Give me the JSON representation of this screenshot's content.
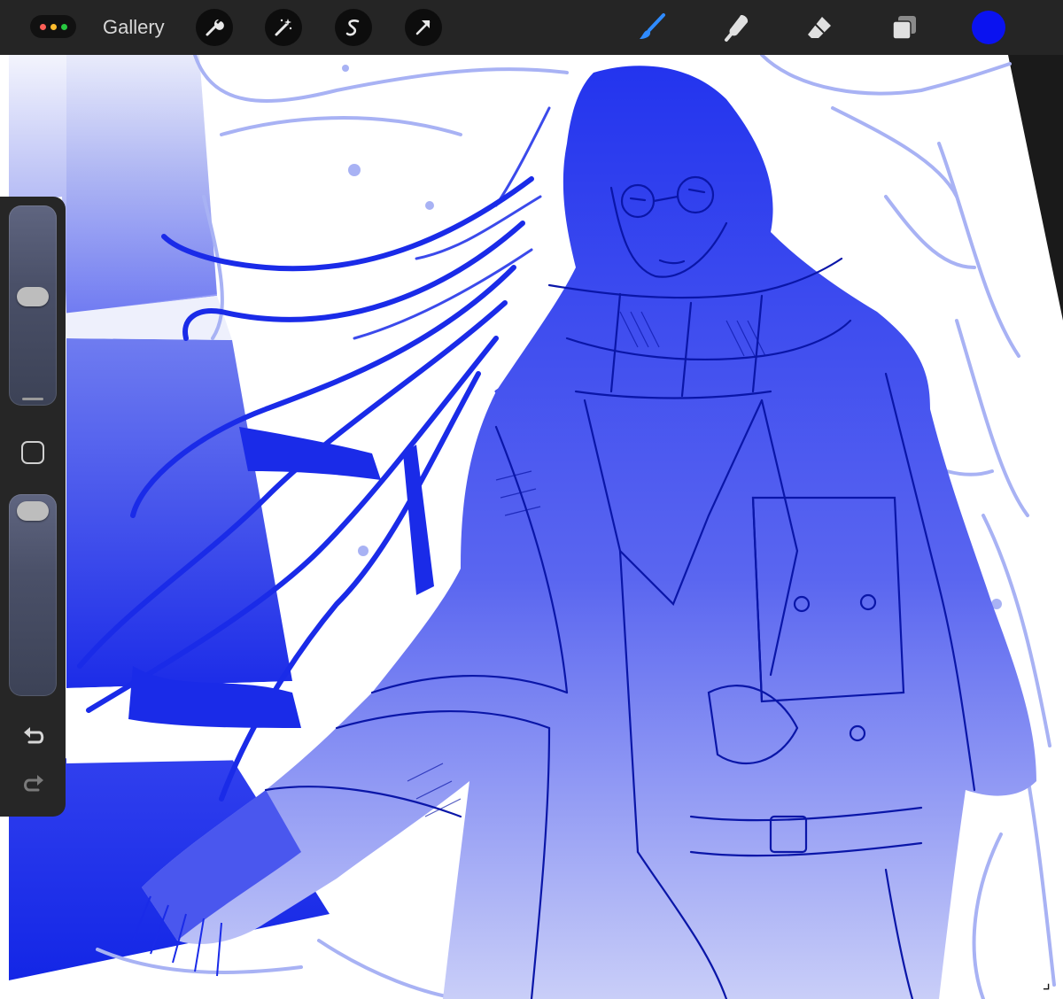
{
  "app": {
    "gallery_label": "Gallery",
    "window_dot_colors": [
      "#ff5f57",
      "#febc2e",
      "#28c840"
    ]
  },
  "toolbar": {
    "left_tools": [
      {
        "name": "actions",
        "icon": "wrench-icon"
      },
      {
        "name": "adjustments",
        "icon": "magic-wand-icon"
      },
      {
        "name": "selection",
        "icon": "selection-s-icon"
      },
      {
        "name": "transform",
        "icon": "arrow-cursor-icon"
      }
    ],
    "right_tools": [
      {
        "name": "brush",
        "icon": "brush-icon",
        "active": true
      },
      {
        "name": "smudge",
        "icon": "smudge-finger-icon",
        "active": false
      },
      {
        "name": "eraser",
        "icon": "eraser-icon",
        "active": false
      },
      {
        "name": "layers",
        "icon": "layers-icon",
        "active": false
      }
    ],
    "current_color": "#0a12f0",
    "active_tool_color": "#2f8bff"
  },
  "sidebar": {
    "brush_size_level": 0.55,
    "brush_opacity_level": 0.98,
    "modify_icon": "square-outline-icon",
    "undo_icon": "undo-arrow-icon",
    "redo_icon": "redo-arrow-icon"
  },
  "canvas": {
    "artwork_description_colors": {
      "background": "#ffffff",
      "ink": "#0a16c8",
      "fill": "#2d3cf0",
      "sketch": "#a8b2f4"
    }
  }
}
